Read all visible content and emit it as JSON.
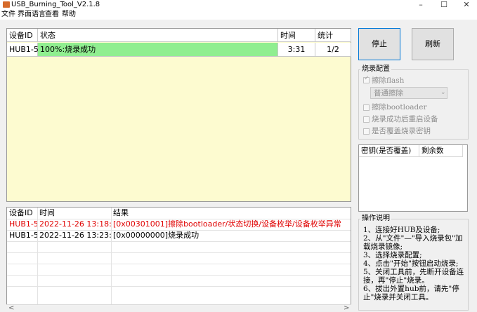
{
  "window": {
    "title": "USB_Burning_Tool_V2.1.8",
    "minimize_glyph": "–",
    "maximize_glyph": "☐",
    "close_glyph": "✕"
  },
  "menu": [
    "文件",
    "界面语言",
    "查看",
    "帮助"
  ],
  "device_table": {
    "headers": [
      "设备ID",
      "状态",
      "时间",
      "统计"
    ],
    "rows": [
      {
        "id": "HUB1-5",
        "status": "100%:烧录成功",
        "time": "3:31",
        "count": "1/2"
      }
    ]
  },
  "buttons": {
    "stop": "停止",
    "refresh": "刷新"
  },
  "burn_config": {
    "legend": "烧录配置",
    "erase_flash": "擦除flash",
    "erase_mode": "普通擦除",
    "erase_bootloader": "擦除bootloader",
    "reboot_after": "烧录成功后重启设备",
    "overwrite_key": "是否覆盖烧录密钥"
  },
  "key_table": {
    "headers": [
      "密钥(是否覆盖)",
      "剩余数"
    ]
  },
  "log_table": {
    "headers": [
      "设备ID",
      "时间",
      "结果"
    ],
    "rows": [
      {
        "id": "HUB1-5",
        "time": "2022-11-26 13:18:...",
        "result": "[0x00301001]擦除bootloader/状态切换/设备枚举/设备枚举异常",
        "color": "#e00000"
      },
      {
        "id": "HUB1-5",
        "time": "2022-11-26 13:23:...",
        "result": "[0x00000000]烧录成功",
        "color": "#000000"
      }
    ]
  },
  "instructions": {
    "legend": "操作说明",
    "text": "1、连接好HUB及设备;\n2、从\"文件\"—\"导入烧录包\"加载烧录镜像;\n3、选择烧录配置;\n4、点击\"开始\"按钮启动烧录;\n5、关闭工具前，先断开设备连接，再\"停止\"烧录。\n6、拔出外置hub前，请先\"停止\"烧录并关闭工具。"
  },
  "colors": {
    "progress_green": "#90ee90",
    "grid_background": "#fdfbd0",
    "error_red": "#e00000"
  },
  "scroll": {
    "left_glyph": "<",
    "right_glyph": ">"
  }
}
